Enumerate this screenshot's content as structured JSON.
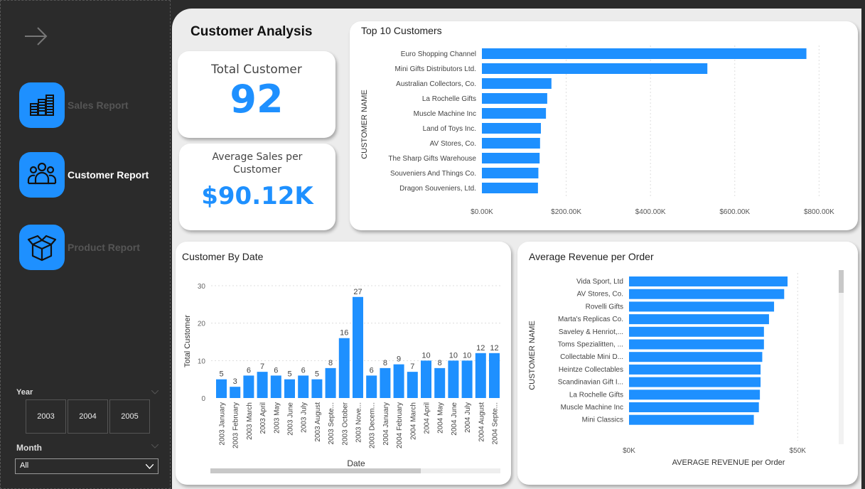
{
  "sidebar": {
    "nav": [
      {
        "label": "Sales Report",
        "icon": "coins-stack-icon",
        "active": false
      },
      {
        "label": "Customer Report",
        "icon": "people-group-icon",
        "active": true
      },
      {
        "label": "Product Report",
        "icon": "box-icon",
        "active": false
      }
    ],
    "year_slicer": {
      "title": "Year",
      "options": [
        "2003",
        "2004",
        "2005"
      ]
    },
    "month_slicer": {
      "title": "Month",
      "value": "All"
    }
  },
  "page_title": "Customer Analysis",
  "kpis": {
    "total_customer": {
      "title": "Total Customer",
      "value": "92"
    },
    "avg_sales": {
      "title_line1": "Average Sales per",
      "title_line2": "Customer",
      "value": "$90.12K"
    }
  },
  "colors": {
    "accent": "#1e90ff",
    "sidebar": "#2b2b2b"
  },
  "chart_data": [
    {
      "type": "bar",
      "orientation": "horizontal",
      "title": "Top 10 Customers",
      "ylabel": "CUSTOMER NAME",
      "xlabel": "",
      "categories": [
        "Euro Shopping Channel",
        "Mini Gifts Distributors Ltd.",
        "Australian Collectors, Co.",
        "La Rochelle Gifts",
        "Muscle Machine Inc",
        "Land of Toys Inc.",
        "AV Stores, Co.",
        "The Sharp Gifts Warehouse",
        "Souveniers And Things Co.",
        "Dragon Souveniers, Ltd."
      ],
      "values": [
        770000,
        535000,
        165000,
        155000,
        152000,
        140000,
        138000,
        137000,
        134000,
        133000
      ],
      "xlim": [
        0,
        850000
      ],
      "xticks": [
        "$0.00K",
        "$200.00K",
        "$400.00K",
        "$600.00K",
        "$800.00K"
      ],
      "xtick_values": [
        0,
        200000,
        400000,
        600000,
        800000
      ],
      "grid": true
    },
    {
      "type": "bar",
      "orientation": "vertical",
      "title": "Customer By Date",
      "xlabel": "Date",
      "ylabel": "Total Customer",
      "categories": [
        "2003 January",
        "2003 February",
        "2003 March",
        "2003 April",
        "2003 May",
        "2003 June",
        "2003 July",
        "2003 August",
        "2003 Septe...",
        "2003 October",
        "2003 Nove...",
        "2003 Decem...",
        "2004 January",
        "2004 February",
        "2004 March",
        "2004 April",
        "2004 May",
        "2004 June",
        "2004 July",
        "2004 August",
        "2004 Septe..."
      ],
      "values": [
        5,
        3,
        6,
        7,
        6,
        5,
        6,
        5,
        8,
        16,
        27,
        6,
        8,
        9,
        7,
        10,
        8,
        10,
        10,
        12,
        12
      ],
      "ylim": [
        0,
        30
      ],
      "yticks": [
        0,
        10,
        20,
        30
      ],
      "grid": true
    },
    {
      "type": "bar",
      "orientation": "horizontal",
      "title": "Average Revenue per Order",
      "ylabel": "CUSTOMER NAME",
      "xlabel": "AVERAGE REVENUE per Order",
      "categories": [
        "Vida Sport, Ltd",
        "AV Stores, Co.",
        "Rovelli Gifts",
        "Marta's Replicas Co.",
        "Saveley & Henriot,...",
        "Toms Spezialitten, ...",
        "Collectable Mini D...",
        "Heintze Collectables",
        "Scandinavian Gift I...",
        "La Rochelle Gifts",
        "Muscle Machine Inc",
        "Mini Classics"
      ],
      "values": [
        47000,
        46000,
        43000,
        41500,
        40000,
        40000,
        39500,
        39000,
        39000,
        38800,
        38500,
        37000
      ],
      "xlim": [
        0,
        55000
      ],
      "xticks": [
        "$0K",
        "$50K"
      ],
      "xtick_values": [
        0,
        50000
      ],
      "grid": true
    }
  ]
}
